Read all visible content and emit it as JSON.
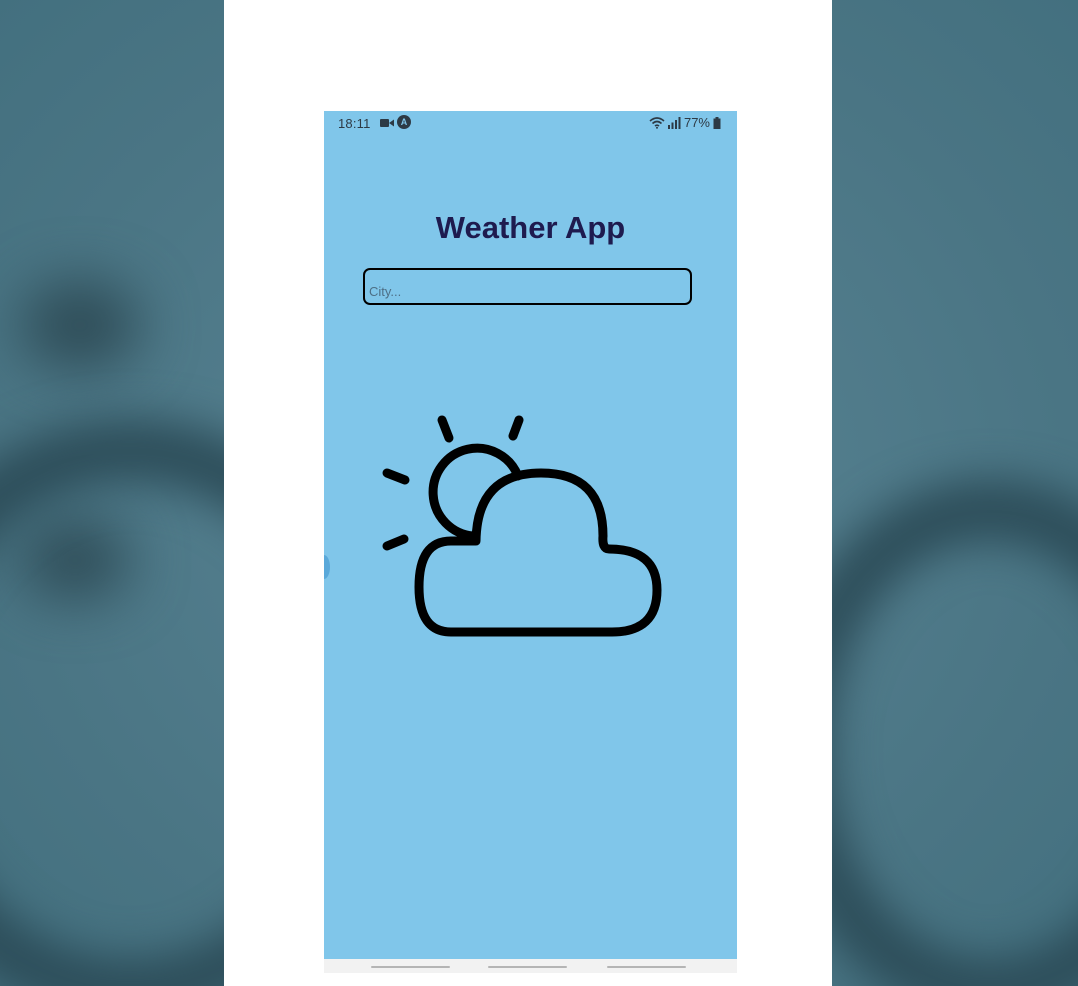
{
  "status_bar": {
    "time": "18:11",
    "battery": "77%"
  },
  "app": {
    "title": "Weather App",
    "city_input": {
      "value": "",
      "placeholder": "City..."
    },
    "weather_icon": "partly-cloudy-icon"
  },
  "colors": {
    "screen_background": "#80c6ea",
    "title": "#1e1b4f",
    "icon_stroke": "#000000"
  }
}
